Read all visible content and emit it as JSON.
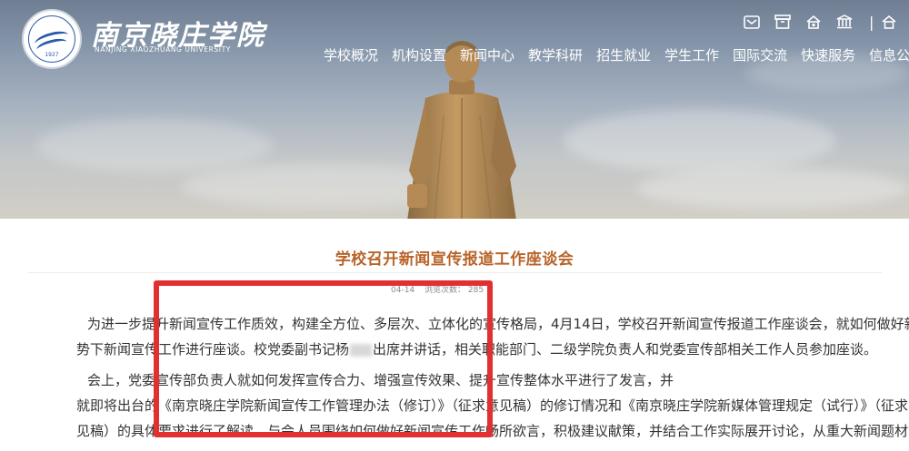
{
  "header": {
    "brand_cn": "南京晓庄学院",
    "brand_en": "NANJING XIAOZHUANG UNIVERSITY",
    "logo_year": "1927",
    "utility_icons": [
      "mail-icon",
      "archive-icon",
      "home-icon",
      "institution-icon",
      "home-icon"
    ],
    "nav": [
      "学校概况",
      "机构设置",
      "新闻中心",
      "教学科研",
      "招生就业",
      "学生工作",
      "国际交流",
      "快速服务",
      "信息公开"
    ]
  },
  "article": {
    "title": "学校召开新闻宣传报道工作座谈会",
    "meta_date": "04-14",
    "meta_views": "浏览次数： 285",
    "p1_line1": "为进一步提升新闻宣传工作质效，构建全方位、多层次、立体化的宣传格局，4月14日，学校召开新闻宣传报道工作座谈会，就如何做好新形",
    "p1_line2a": "势下新闻宣传工作进行座谈。校党委副书记杨",
    "p1_line2b": "出席并讲话，相关职能部门、二级学院负责人和党委宣传部相关工作人员参加座谈。",
    "p2_line1": "会上，党委宣传部负责人就如何发挥宣传合力、增强宣传效果、提升宣传整体水平进行了发言，并",
    "p2_line2": "就即将出台的《南京晓庄学院新闻宣传工作管理办法（修订）》（征求意见稿）的修订情况和《南京晓庄学院新媒体管理规定（试行）》（征求意",
    "p2_line3": "见稿）的具体要求进行了解读。与会人员围绕如何做好新闻宣传工作畅所欲言，积极建议献策，并结合工作实际展开讨论，从重大新闻题材策划、"
  },
  "colors": {
    "title": "#b8642a",
    "annotation_box": "#e23030"
  }
}
